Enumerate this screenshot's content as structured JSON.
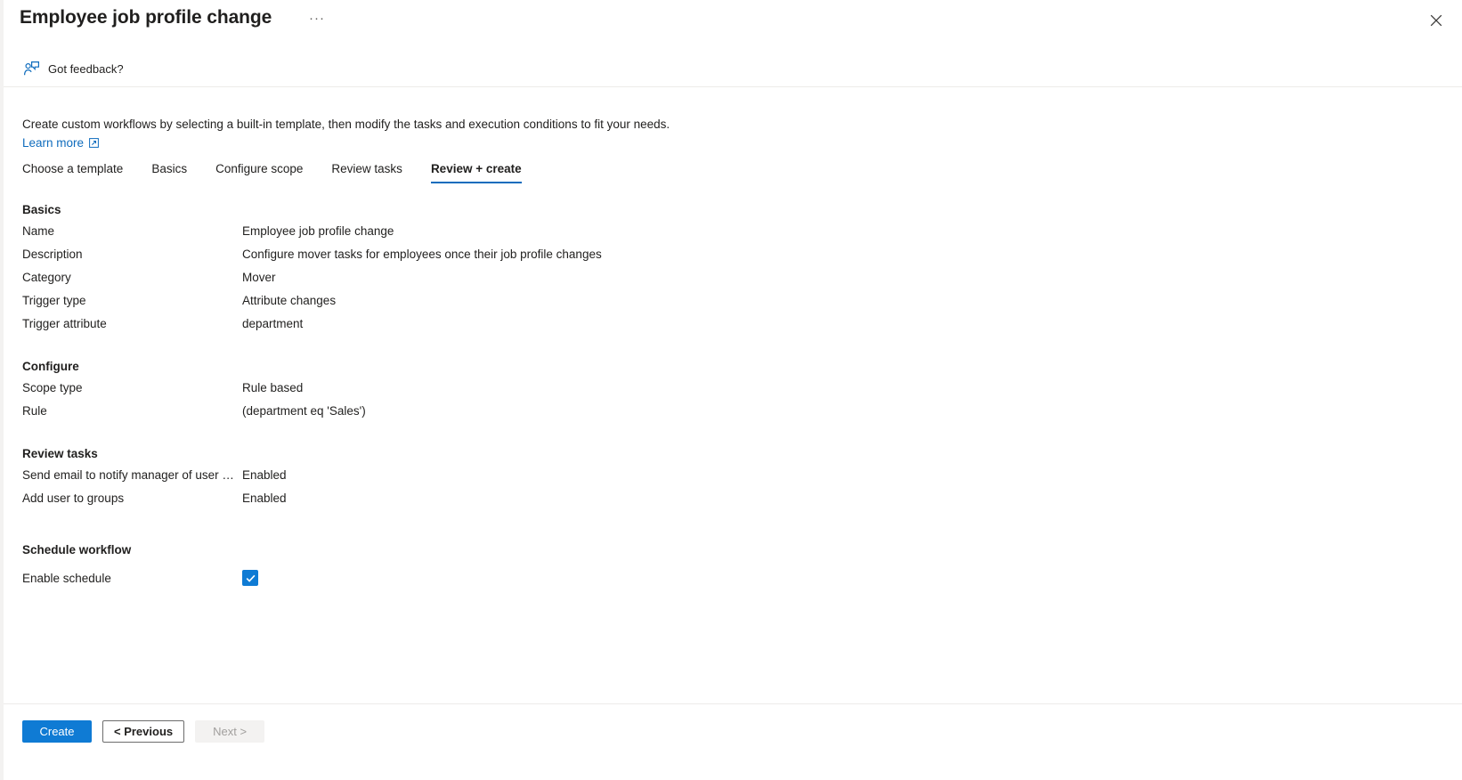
{
  "blade": {
    "title": "Employee job profile change",
    "ellipsis_label": "···",
    "close_icon": "close-icon",
    "accent_color": "#0f6cbd",
    "primary_button_color": "#0f7bd4",
    "checkbox_color": "#0f7bd4"
  },
  "commandbar": {
    "feedback_label": "Got feedback?",
    "feedback_icon": "person-feedback-icon"
  },
  "intro": {
    "description": "Create custom workflows by selecting a built-in template, then modify the tasks and execution conditions to fit your needs.",
    "learn_more_label": "Learn more",
    "learn_more_icon": "external-link-icon"
  },
  "tabs": [
    {
      "label": "Choose a template",
      "active": false
    },
    {
      "label": "Basics",
      "active": false
    },
    {
      "label": "Configure scope",
      "active": false
    },
    {
      "label": "Review tasks",
      "active": false
    },
    {
      "label": "Review + create",
      "active": true
    }
  ],
  "sections": [
    {
      "heading": "Basics",
      "rows": [
        {
          "label": "Name",
          "value": "Employee job profile change"
        },
        {
          "label": "Description",
          "value": "Configure mover tasks for employees once their job profile changes"
        },
        {
          "label": "Category",
          "value": "Mover"
        },
        {
          "label": "Trigger type",
          "value": "Attribute changes"
        },
        {
          "label": "Trigger attribute",
          "value": "department"
        }
      ]
    },
    {
      "heading": "Configure",
      "rows": [
        {
          "label": "Scope type",
          "value": "Rule based"
        },
        {
          "label": "Rule",
          "value": "(department eq 'Sales')"
        }
      ]
    },
    {
      "heading": "Review tasks",
      "rows": [
        {
          "label": "Send email to notify manager of user mo…",
          "value": "Enabled"
        },
        {
          "label": "Add user to groups",
          "value": "Enabled"
        }
      ]
    }
  ],
  "schedule": {
    "heading": "Schedule workflow",
    "enable_label": "Enable schedule",
    "enable_checked": true
  },
  "footer": {
    "create_label": "Create",
    "previous_label": "< Previous",
    "next_label": "Next >",
    "next_disabled": true
  }
}
